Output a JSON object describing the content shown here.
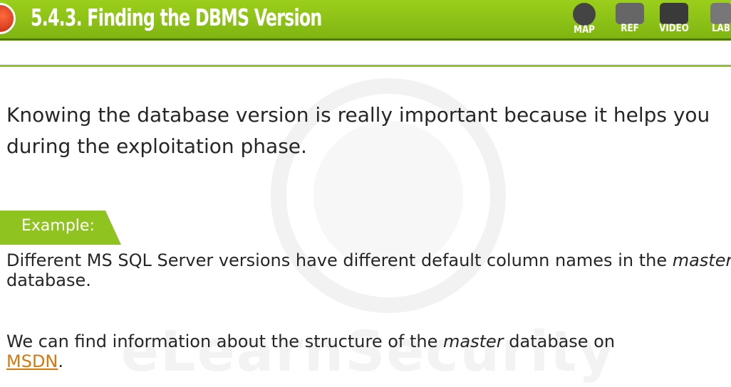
{
  "header": {
    "title": "5.4.3. Finding the DBMS Version",
    "nav": [
      {
        "label": "MAP",
        "icon": "globe-icon"
      },
      {
        "label": "REF",
        "icon": "folder-icon"
      },
      {
        "label": "VIDEO",
        "icon": "film-icon"
      },
      {
        "label": "LAB",
        "icon": "flask-icon"
      }
    ]
  },
  "body": {
    "intro": "Knowing the database version is really important because it helps you during the exploitation phase.",
    "example_label": "Example:",
    "para2_a": "Different MS SQL Server versions have different default column names in the ",
    "para2_em": "master",
    "para2_b": " database.",
    "para3_a": "We can find information about the structure of the ",
    "para3_em": "master",
    "para3_b": " database on ",
    "para3_link": "MSDN",
    "para3_c": "."
  },
  "watermark": "eLearnSecurity",
  "colors": {
    "header_green": "#8fc31f",
    "link": "#d8780c",
    "text": "#262626"
  }
}
